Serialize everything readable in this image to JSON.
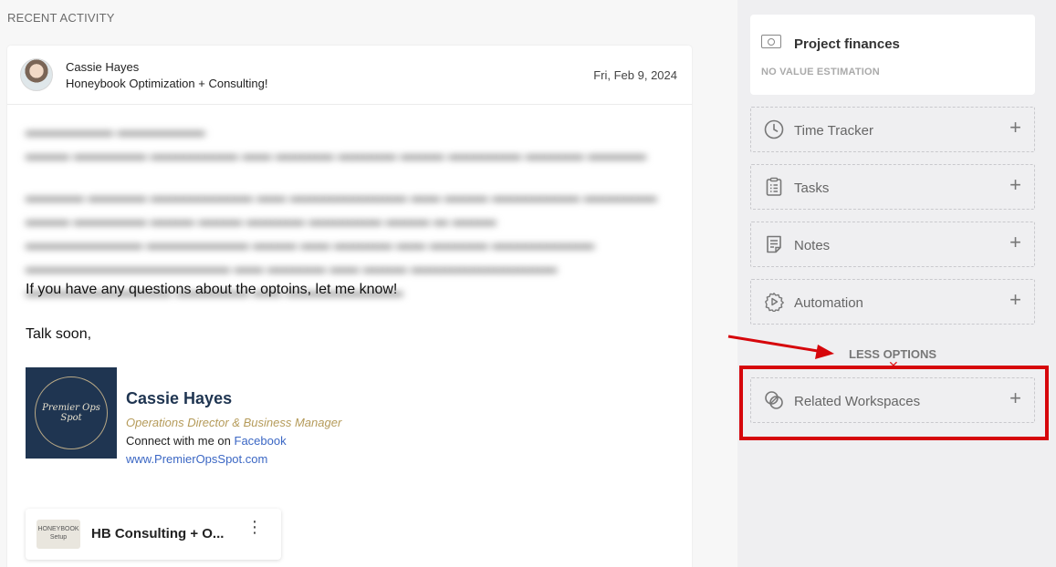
{
  "recent_activity": {
    "label": "RECENT ACTIVITY"
  },
  "message": {
    "sender_name": "Cassie Hayes",
    "subject": "Honeybook Optimization + Consulting!",
    "date": "Fri, Feb 9, 2024",
    "body_questions": "If you have any questions about the optoins, let me know!",
    "body_signoff": "Talk soon,"
  },
  "signature": {
    "logo_text": "Premier Ops Spot",
    "name": "Cassie Hayes",
    "title": "Operations Director & Business Manager",
    "connect_prefix": "Connect with me on ",
    "connect_link": "Facebook",
    "website": "www.PremierOpsSpot.com"
  },
  "attachment": {
    "thumb_text": "HONEYBOOK Setup",
    "name": "HB Consulting + O...",
    "menu": "⋮"
  },
  "sidebar": {
    "project_finances": {
      "title": "Project finances",
      "subtitle": "NO VALUE ESTIMATION"
    },
    "options": [
      {
        "label": "Time Tracker",
        "icon": "clock-icon"
      },
      {
        "label": "Tasks",
        "icon": "clipboard-icon"
      },
      {
        "label": "Notes",
        "icon": "note-icon"
      },
      {
        "label": "Automation",
        "icon": "gear-play-icon"
      }
    ],
    "less_options": "LESS OPTIONS",
    "related_workspaces": {
      "label": "Related Workspaces",
      "icon": "overlap-circles-icon"
    },
    "plus": "+"
  },
  "colors": {
    "annotation_red": "#d6060b",
    "signature_navy": "#1f3551",
    "signature_gold": "#b59b5a",
    "link_blue": "#3b67c4"
  }
}
